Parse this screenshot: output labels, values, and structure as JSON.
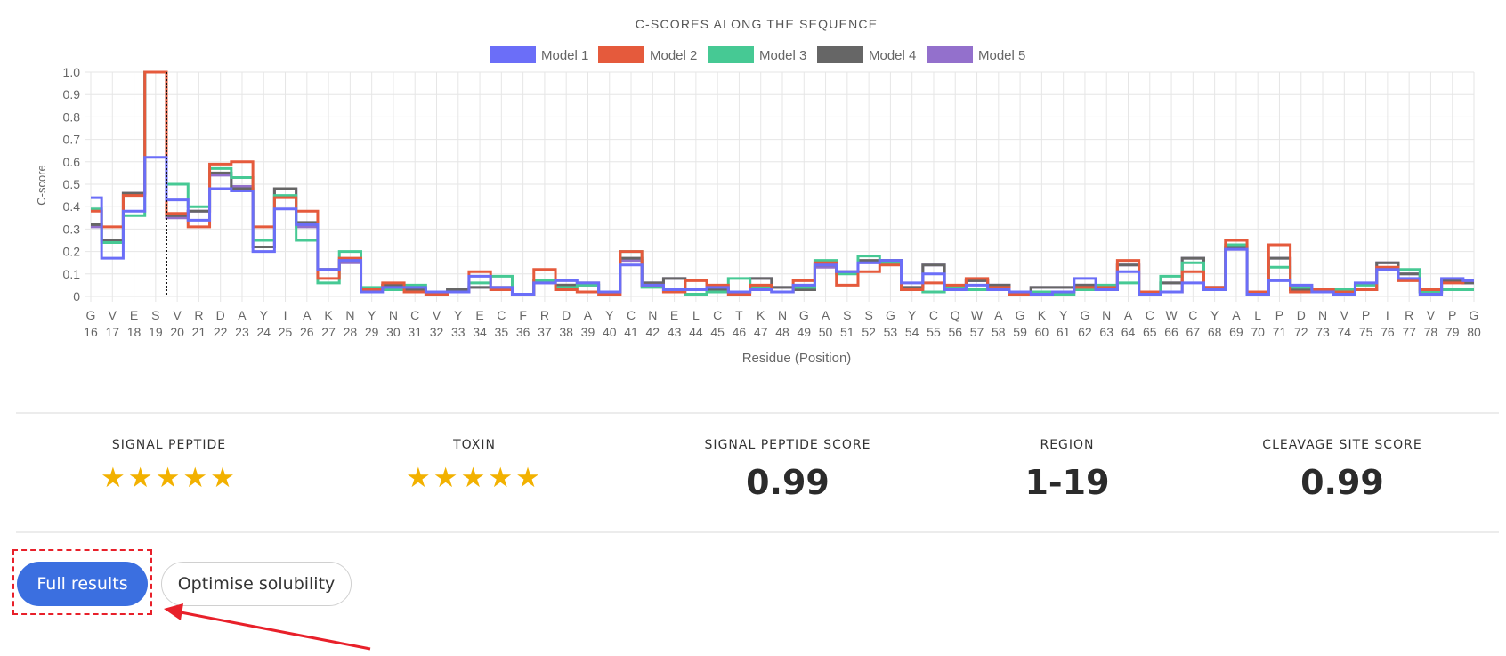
{
  "chart_data": {
    "type": "line",
    "title": "C-SCORES ALONG THE SEQUENCE",
    "xlabel": "Residue (Position)",
    "ylabel": "C-score",
    "ylim": [
      0,
      1
    ],
    "yticks": [
      "1.0",
      "0.9",
      "0.8",
      "0.7",
      "0.6",
      "0.5",
      "0.4",
      "0.3",
      "0.2",
      "0.1",
      "0"
    ],
    "grid": true,
    "legend_position": "top",
    "step": true,
    "cleavage_marker_index": 3.5,
    "residues": [
      "G",
      "V",
      "E",
      "S",
      "V",
      "R",
      "D",
      "A",
      "Y",
      "I",
      "A",
      "K",
      "N",
      "Y",
      "N",
      "C",
      "V",
      "Y",
      "E",
      "C",
      "F",
      "R",
      "D",
      "A",
      "Y",
      "C",
      "N",
      "E",
      "L",
      "C",
      "T",
      "K",
      "N",
      "G",
      "A",
      "S",
      "S",
      "G",
      "Y",
      "C",
      "Q",
      "W",
      "A",
      "G",
      "K",
      "Y",
      "G",
      "N",
      "A",
      "C",
      "W",
      "C",
      "Y",
      "A",
      "L",
      "P",
      "D",
      "N",
      "V",
      "P",
      "I",
      "R",
      "V",
      "P",
      "G"
    ],
    "positions": [
      "16",
      "17",
      "18",
      "19",
      "20",
      "21",
      "22",
      "23",
      "24",
      "25",
      "26",
      "27",
      "28",
      "29",
      "30",
      "31",
      "32",
      "33",
      "34",
      "35",
      "36",
      "37",
      "38",
      "39",
      "40",
      "41",
      "42",
      "43",
      "44",
      "45",
      "46",
      "47",
      "48",
      "49",
      "50",
      "51",
      "52",
      "53",
      "54",
      "55",
      "56",
      "57",
      "58",
      "59",
      "60",
      "61",
      "62",
      "63",
      "64",
      "65",
      "66",
      "67",
      "68",
      "69",
      "70",
      "71",
      "72",
      "73",
      "74",
      "75",
      "76",
      "77",
      "78",
      "79",
      "80"
    ],
    "series": [
      {
        "name": "Model 1",
        "color": "#6b6ef8",
        "values": [
          0.44,
          0.17,
          0.38,
          0.62,
          0.43,
          0.34,
          0.48,
          0.47,
          0.2,
          0.39,
          0.32,
          0.12,
          0.16,
          0.02,
          0.04,
          0.04,
          0.02,
          0.02,
          0.09,
          0.04,
          0.01,
          0.06,
          0.07,
          0.06,
          0.02,
          0.14,
          0.05,
          0.03,
          0.03,
          0.04,
          0.02,
          0.03,
          0.02,
          0.05,
          0.14,
          0.11,
          0.15,
          0.16,
          0.06,
          0.1,
          0.03,
          0.05,
          0.03,
          0.02,
          0.01,
          0.02,
          0.08,
          0.03,
          0.11,
          0.01,
          0.02,
          0.06,
          0.03,
          0.21,
          0.01,
          0.07,
          0.05,
          0.02,
          0.01,
          0.06,
          0.12,
          0.08,
          0.01,
          0.08,
          0.07
        ]
      },
      {
        "name": "Model 2",
        "color": "#e55a3c",
        "values": [
          0.38,
          0.31,
          0.45,
          1.0,
          0.37,
          0.31,
          0.59,
          0.6,
          0.31,
          0.44,
          0.38,
          0.08,
          0.17,
          0.03,
          0.06,
          0.02,
          0.01,
          0.02,
          0.11,
          0.03,
          0.01,
          0.12,
          0.03,
          0.02,
          0.01,
          0.2,
          0.05,
          0.02,
          0.07,
          0.05,
          0.01,
          0.05,
          0.02,
          0.07,
          0.15,
          0.05,
          0.11,
          0.14,
          0.03,
          0.06,
          0.05,
          0.08,
          0.04,
          0.01,
          0.01,
          0.02,
          0.04,
          0.04,
          0.16,
          0.02,
          0.02,
          0.11,
          0.04,
          0.25,
          0.02,
          0.23,
          0.02,
          0.03,
          0.02,
          0.03,
          0.13,
          0.07,
          0.03,
          0.06,
          0.07
        ]
      },
      {
        "name": "Model 3",
        "color": "#46c994",
        "values": [
          0.39,
          0.24,
          0.36,
          1.0,
          0.5,
          0.4,
          0.57,
          0.53,
          0.25,
          0.45,
          0.25,
          0.06,
          0.2,
          0.04,
          0.03,
          0.05,
          0.02,
          0.02,
          0.06,
          0.09,
          0.01,
          0.07,
          0.04,
          0.05,
          0.02,
          0.2,
          0.04,
          0.02,
          0.01,
          0.02,
          0.08,
          0.04,
          0.02,
          0.04,
          0.16,
          0.1,
          0.18,
          0.15,
          0.03,
          0.02,
          0.04,
          0.03,
          0.03,
          0.02,
          0.02,
          0.01,
          0.03,
          0.05,
          0.06,
          0.02,
          0.09,
          0.15,
          0.03,
          0.23,
          0.01,
          0.13,
          0.04,
          0.03,
          0.03,
          0.05,
          0.12,
          0.12,
          0.02,
          0.03,
          0.03
        ]
      },
      {
        "name": "Model 4",
        "color": "#666666",
        "values": [
          0.32,
          0.25,
          0.46,
          1.0,
          0.36,
          0.38,
          0.55,
          0.48,
          0.22,
          0.48,
          0.33,
          0.12,
          0.16,
          0.03,
          0.05,
          0.03,
          0.02,
          0.03,
          0.04,
          0.04,
          0.01,
          0.07,
          0.05,
          0.06,
          0.02,
          0.17,
          0.06,
          0.08,
          0.03,
          0.03,
          0.02,
          0.08,
          0.04,
          0.03,
          0.14,
          0.11,
          0.16,
          0.16,
          0.04,
          0.14,
          0.03,
          0.07,
          0.05,
          0.01,
          0.04,
          0.04,
          0.05,
          0.03,
          0.14,
          0.01,
          0.06,
          0.17,
          0.04,
          0.22,
          0.01,
          0.17,
          0.03,
          0.02,
          0.02,
          0.03,
          0.15,
          0.1,
          0.02,
          0.07,
          0.06
        ]
      },
      {
        "name": "Model 5",
        "color": "#9370cc",
        "values": [
          0.31,
          0.25,
          0.46,
          1.0,
          0.35,
          0.38,
          0.54,
          0.49,
          0.22,
          0.48,
          0.31,
          0.12,
          0.15,
          0.03,
          0.05,
          0.03,
          0.02,
          0.03,
          0.04,
          0.04,
          0.01,
          0.06,
          0.05,
          0.05,
          0.02,
          0.16,
          0.06,
          0.08,
          0.03,
          0.03,
          0.02,
          0.08,
          0.04,
          0.03,
          0.13,
          0.11,
          0.15,
          0.16,
          0.04,
          0.14,
          0.03,
          0.07,
          0.05,
          0.01,
          0.04,
          0.04,
          0.05,
          0.03,
          0.14,
          0.01,
          0.06,
          0.17,
          0.04,
          0.21,
          0.01,
          0.17,
          0.03,
          0.02,
          0.02,
          0.03,
          0.15,
          0.1,
          0.02,
          0.07,
          0.06
        ]
      }
    ]
  },
  "stats": {
    "signal_peptide": {
      "label": "Signal peptide",
      "stars": "★★★★★",
      "rating": 5
    },
    "toxin": {
      "label": "Toxin",
      "stars": "★★★★★",
      "rating": 5
    },
    "signal_peptide_score": {
      "label": "Signal peptide score",
      "value": "0.99"
    },
    "region": {
      "label": "Region",
      "value": "1-19"
    },
    "cleavage_site_score": {
      "label": "Cleavage site score",
      "value": "0.99"
    }
  },
  "actions": {
    "full_results_label": "Full results",
    "optimise_label": "Optimise solubility"
  },
  "colors": {
    "primary_button": "#3b6fe0",
    "star": "#f2b100",
    "annotation": "#e8202a"
  }
}
